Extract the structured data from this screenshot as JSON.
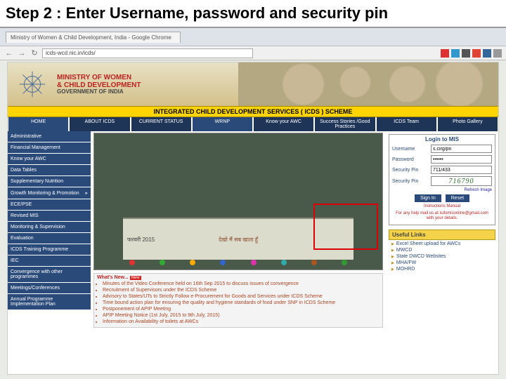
{
  "slide": {
    "title": "Step 2 : Enter Username, password and security pin"
  },
  "browser": {
    "tab_title": "Ministry of Women & Child Development, India - Google Chrome",
    "url": "icds-wcd.nic.in/icds/"
  },
  "header": {
    "ministry_line1": "MINISTRY OF WOMEN",
    "ministry_line2": "& CHILD DEVELOPMENT",
    "gov_line": "GOVERNMENT OF INDIA",
    "scheme_title": "INTEGRATED CHILD DEVELOPMENT SERVICES ( ICDS ) SCHEME"
  },
  "topnav": [
    "HOME",
    "ABOUT ICDS",
    "CURRENT STATUS",
    "WRNP",
    "Know your AWC",
    "Success Stories /Good Practices",
    "ICDS Team",
    "Photo Gallery"
  ],
  "leftnav": [
    "Administrative",
    "Financial Management",
    "Know your AWC",
    "Data Tables",
    "Supplementary Nutrition",
    "Growth Monitoring & Promotion",
    "ECE/PSE",
    "Revised MIS",
    "Monitoring & Supervision",
    "Evaluation",
    "ICDS Training Programme",
    "IEC",
    "Convergence with other programmes",
    "Meetings/Conferences",
    "Annual Programme Implementation Plan"
  ],
  "photo": {
    "caption": "देखो मैं सब खाता हूँ",
    "date_label": "फरवरी 2015"
  },
  "whatsnew": {
    "header": "What's New...",
    "new_tag": "New",
    "items": [
      "Minutes of the Video Conference held on 16th Sep 2015 to discuss issues of convergence",
      "Recruitment of Supervisors under the ICDS Scheme",
      "Advisory to States/UTs to Strictly Follow e-Procurement for Goods and Services under ICDS Scheme",
      "Time bound action plan for ensuring the quality and hygiene standards of food under SNP in ICDS Scheme",
      "Postponement of APIP Meeting",
      "APIP Meeting Notice (1st July, 2015 to 9th July, 2015)",
      "Information on Availability of toilets at AWCs"
    ]
  },
  "login": {
    "title": "Login to MIS",
    "username_label": "Username",
    "username_value": "s.cirg/pn",
    "password_label": "Password",
    "password_value": "••••••",
    "secpin_label": "Security Pin",
    "secpin_value": "711/433",
    "captcha_label": "Security Pin",
    "captcha_text": "716790",
    "refresh_label": "Refresh Image",
    "signin_label": "Sign In",
    "reset_label": "Reset",
    "help_line1": "Instructions Manual",
    "help_line2": "For any help mail us at icdsmisonline@gmail.com with your details."
  },
  "useful": {
    "header": "Useful Links",
    "items": [
      "Excel Sheet upload for AWCs",
      "MWCD",
      "State DWCD Websites",
      "MHA/FW",
      "MOHRD"
    ]
  }
}
